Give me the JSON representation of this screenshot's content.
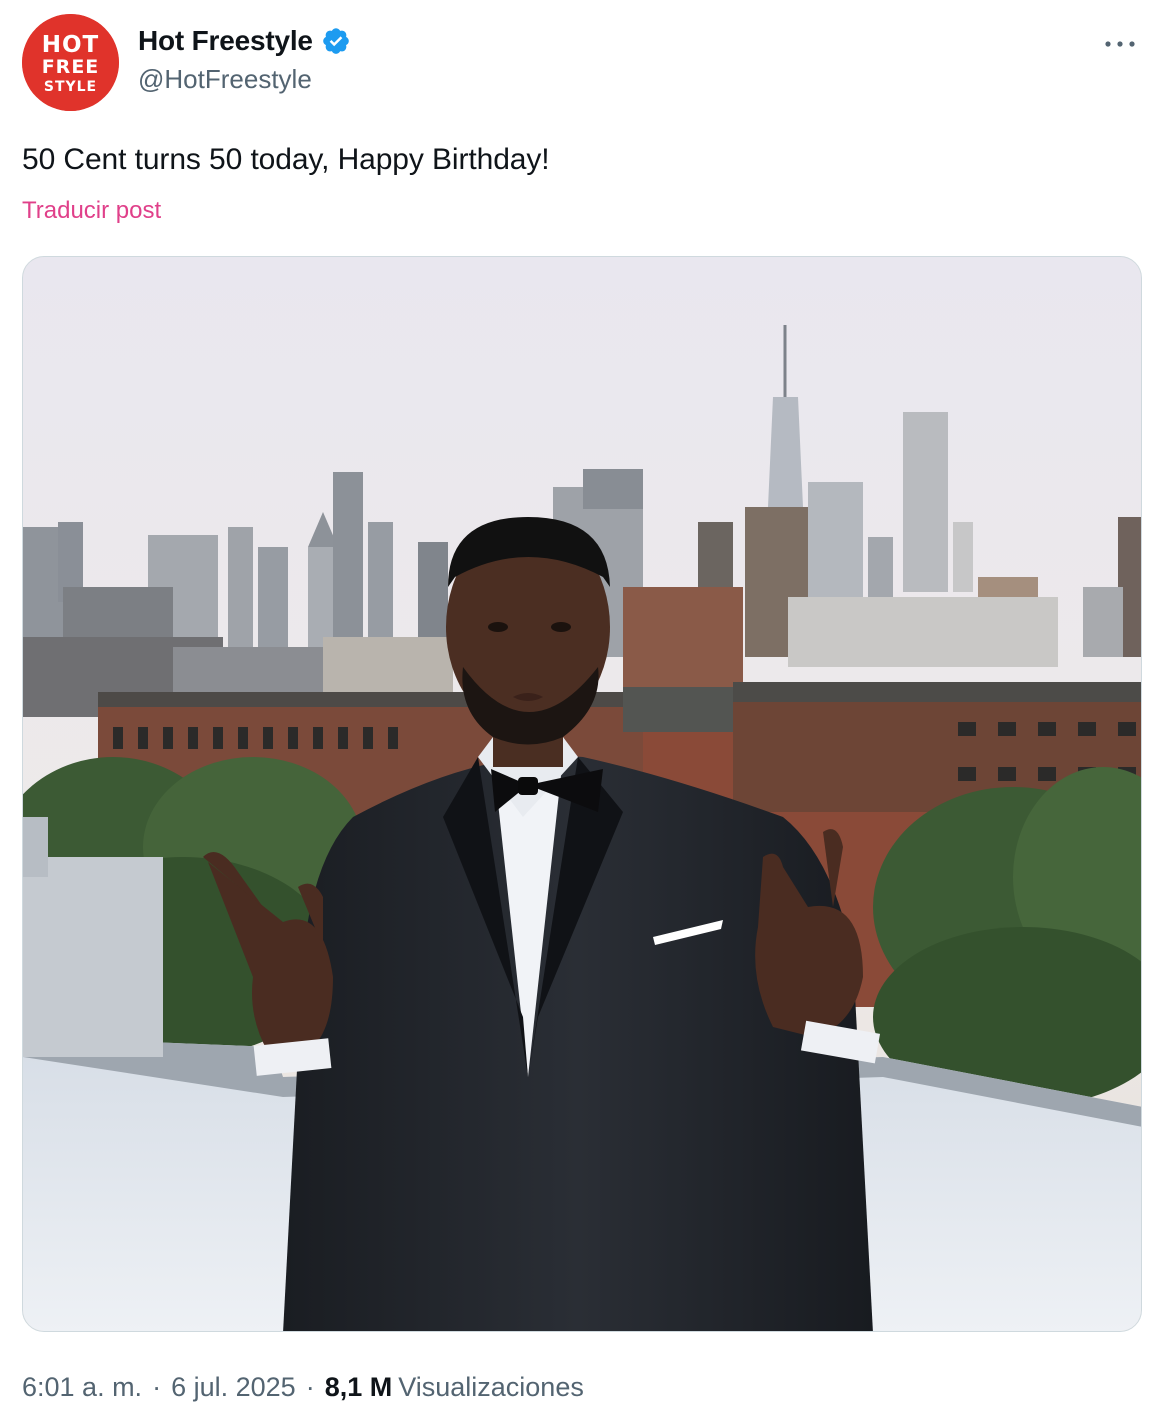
{
  "account": {
    "display_name": "Hot Freestyle",
    "handle": "@HotFreestyle",
    "verified": true,
    "logo_text": [
      "HOT",
      "FREE",
      "STYLE"
    ],
    "logo_color": "#e0332b",
    "verified_color": "#1d9bf0"
  },
  "post": {
    "text": "50 Cent turns 50 today, Happy Birthday!",
    "translate_label": "Traducir post",
    "translate_color": "#e0408a"
  },
  "media": {
    "icon": "photo"
  },
  "meta": {
    "time": "6:01 a. m.",
    "separator": "·",
    "date": "6 jul. 2025",
    "views_count": "8,1 M",
    "views_label": "Visualizaciones"
  },
  "menu": {
    "icon": "more-horizontal-icon"
  }
}
